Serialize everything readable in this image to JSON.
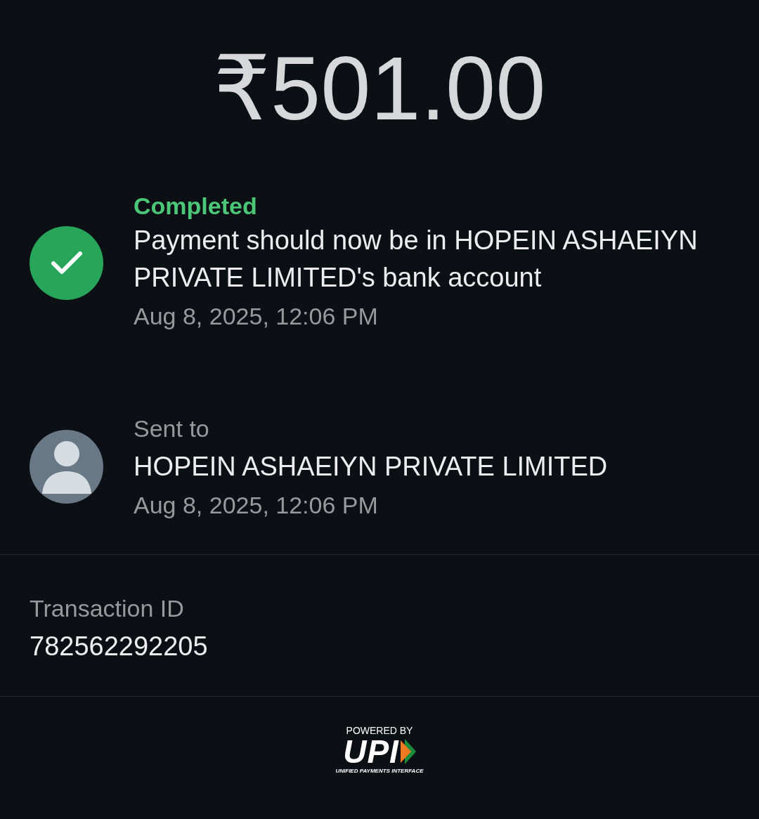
{
  "amount": "₹501.00",
  "status": {
    "kind": "completed",
    "label": "Completed",
    "message": "Payment should now be in HOPEIN ASHAEIYN PRIVATE LIMITED's bank account",
    "time": "Aug 8, 2025, 12:06 PM"
  },
  "recipient": {
    "label": "Sent to",
    "name": "HOPEIN ASHAEIYN PRIVATE LIMITED",
    "time": "Aug 8, 2025, 12:06 PM"
  },
  "transaction": {
    "label": "Transaction ID",
    "value": "782562292205"
  },
  "footer": {
    "powered_by": "POWERED BY",
    "logo": "UPI",
    "tagline": "UNIFIED PAYMENTS INTERFACE"
  }
}
